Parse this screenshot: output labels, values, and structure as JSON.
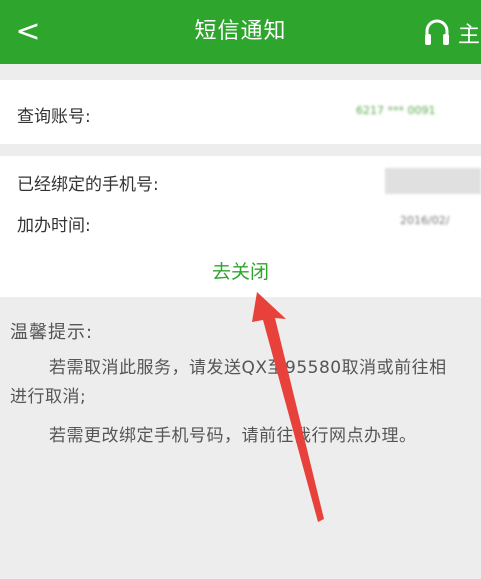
{
  "header": {
    "back_label": "<",
    "title": "短信通知",
    "support_label": "主"
  },
  "account": {
    "label": "查询账号:",
    "value": "6217 *** 0091"
  },
  "binding": {
    "phone_label": "已经绑定的手机号:",
    "phone_value": "",
    "time_label": "加办时间:",
    "time_value": "2016/02/"
  },
  "actions": {
    "close_label": "去关闭"
  },
  "tips": {
    "title": "温馨提示:",
    "line1": "若需取消此服务，请发送QX至95580取消或前往相",
    "line2": "进行取消;",
    "line3": "若需更改绑定手机号码，请前往我行网点办理。"
  },
  "colors": {
    "brand_green": "#2ea52d",
    "annotation_arrow": "#e8403a"
  }
}
